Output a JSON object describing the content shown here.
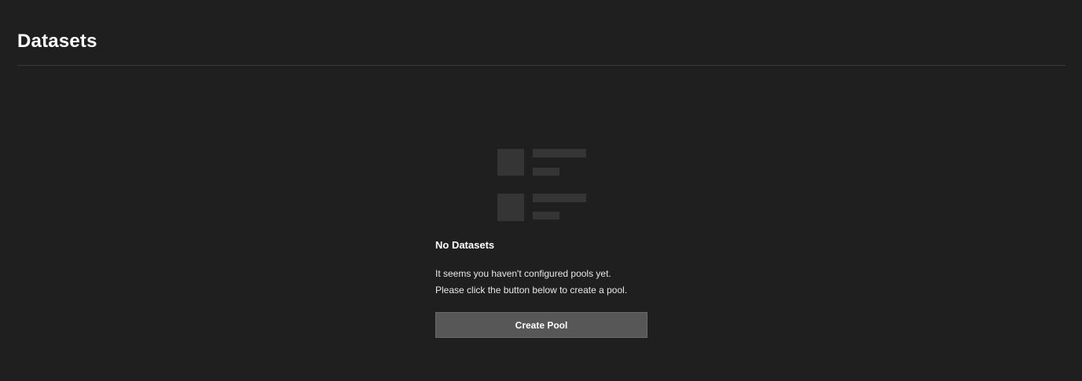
{
  "header": {
    "title": "Datasets"
  },
  "empty_state": {
    "illustration_icon": "list-placeholder-icon",
    "title": "No Datasets",
    "message_line_1": "It seems you haven't configured pools yet.",
    "message_line_2": "Please click the button below to create a pool.",
    "button_label": "Create Pool"
  },
  "colors": {
    "background": "#1f1f1f",
    "placeholder": "#353535",
    "button_bg": "#575757",
    "divider": "#3a3a3a"
  }
}
